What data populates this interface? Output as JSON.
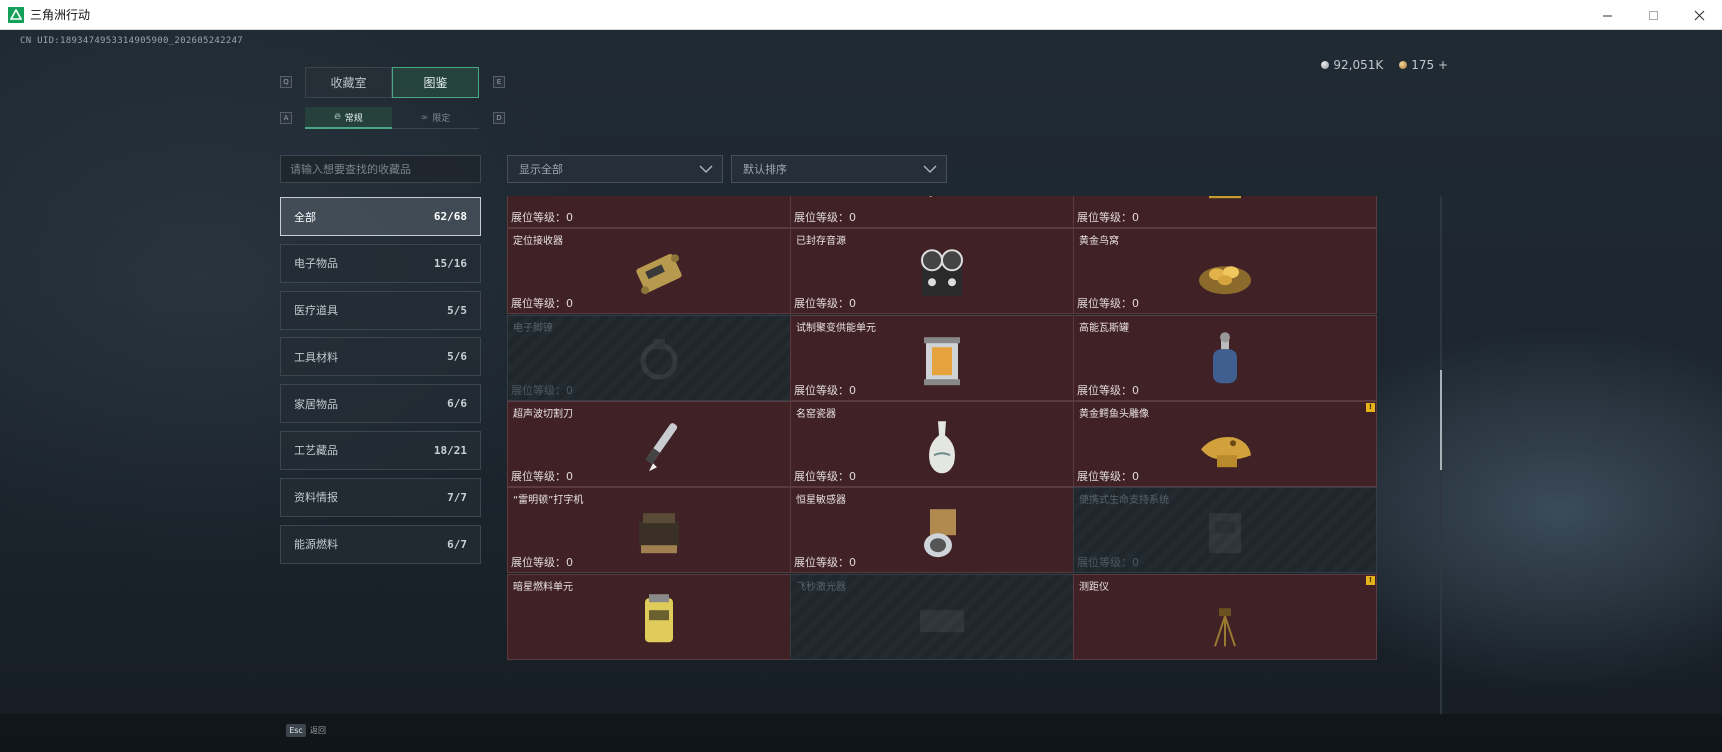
{
  "window": {
    "title": "三角洲行动",
    "controls": [
      "minimize",
      "maximize",
      "close"
    ]
  },
  "header": {
    "uid": "CN UID:1893474953314905900_202605242247",
    "currency": [
      {
        "icon": "silver-coin-icon",
        "value": "92,051K"
      },
      {
        "icon": "gold-coin-icon",
        "value": "175 +"
      }
    ]
  },
  "tabs": {
    "hint_left": "Q",
    "hint_right": "E",
    "items": [
      {
        "label": "收藏室",
        "active": false
      },
      {
        "label": "图鉴",
        "active": true
      }
    ]
  },
  "subtabs": {
    "hint_left": "A",
    "hint_right": "D",
    "items": [
      {
        "label": "常规",
        "icon": "flame-icon",
        "active": true
      },
      {
        "label": "限定",
        "icon": "infinity-icon",
        "active": false
      }
    ]
  },
  "search": {
    "placeholder": "请输入想要查找的收藏品"
  },
  "filters": {
    "display": "显示全部",
    "sort": "默认排序"
  },
  "categories": [
    {
      "label": "全部",
      "count": "62/68",
      "active": true
    },
    {
      "label": "电子物品",
      "count": "15/16",
      "active": false
    },
    {
      "label": "医疗道具",
      "count": "5/5",
      "active": false
    },
    {
      "label": "工具材料",
      "count": "5/6",
      "active": false
    },
    {
      "label": "家居物品",
      "count": "6/6",
      "active": false
    },
    {
      "label": "工艺藏品",
      "count": "18/21",
      "active": false
    },
    {
      "label": "资料情报",
      "count": "7/7",
      "active": false
    },
    {
      "label": "能源燃料",
      "count": "6/7",
      "active": false
    }
  ],
  "items": [
    {
      "name": "",
      "level": "展位等级：0",
      "locked": false,
      "warn": false,
      "icon": "gear-assembly-icon"
    },
    {
      "name": "",
      "level": "展位等级：0",
      "locked": false,
      "warn": false,
      "icon": "painting-icon"
    },
    {
      "name": "",
      "level": "展位等级：0",
      "locked": false,
      "warn": false,
      "icon": "gold-frame-icon"
    },
    {
      "name": "定位接收器",
      "level": "展位等级：0",
      "locked": false,
      "warn": false,
      "icon": "receiver-icon"
    },
    {
      "name": "已封存音源",
      "level": "展位等级：0",
      "locked": false,
      "warn": false,
      "icon": "reel-recorder-icon"
    },
    {
      "name": "黄金鸟窝",
      "level": "展位等级：0",
      "locked": false,
      "warn": false,
      "icon": "gold-nest-icon"
    },
    {
      "name": "电子脚镣",
      "level": "展位等级：0",
      "locked": true,
      "warn": false,
      "icon": "anklet-icon"
    },
    {
      "name": "试制聚变供能单元",
      "level": "展位等级：0",
      "locked": false,
      "warn": false,
      "icon": "fusion-cell-icon"
    },
    {
      "name": "高能瓦斯罐",
      "level": "展位等级：0",
      "locked": false,
      "warn": false,
      "icon": "gas-canister-icon"
    },
    {
      "name": "超声波切割刀",
      "level": "展位等级：0",
      "locked": false,
      "warn": false,
      "icon": "cutter-knife-icon"
    },
    {
      "name": "名窑瓷器",
      "level": "展位等级：0",
      "locked": false,
      "warn": true,
      "icon": "porcelain-vase-icon"
    },
    {
      "name": "黄金鳄鱼头雕像",
      "level": "展位等级：0",
      "locked": false,
      "warn": true,
      "icon": "gold-crocodile-icon"
    },
    {
      "name": "“雷明顿”打字机",
      "level": "展位等级：0",
      "locked": false,
      "warn": false,
      "icon": "typewriter-icon"
    },
    {
      "name": "恒星敏感器",
      "level": "展位等级：0",
      "locked": false,
      "warn": true,
      "icon": "star-sensor-icon"
    },
    {
      "name": "便携式生命支持系统",
      "level": "展位等级：0",
      "locked": true,
      "warn": false,
      "icon": "life-support-icon"
    },
    {
      "name": "暗星燃料单元",
      "level": "",
      "locked": false,
      "warn": false,
      "icon": "fuel-cell-icon"
    },
    {
      "name": "飞秒激光器",
      "level": "",
      "locked": true,
      "warn": false,
      "icon": "laser-icon"
    },
    {
      "name": "测距仪",
      "level": "",
      "locked": false,
      "warn": true,
      "icon": "rangefinder-icon"
    }
  ],
  "footer": {
    "esc_key": "Esc",
    "esc_label": "返回"
  },
  "colors": {
    "accent": "#4aa886",
    "card_unlocked": "#3f2126",
    "warn": "#e6b21a"
  }
}
